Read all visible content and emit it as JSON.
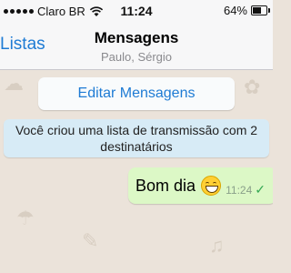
{
  "status_bar": {
    "carrier": "Claro BR",
    "time": "11:24",
    "battery_percent": "64%",
    "battery_level": 0.64,
    "wifi_icon": "wifi-icon",
    "signal_icon": "signal-dots-icon"
  },
  "nav": {
    "back_label": "Listas",
    "title": "Mensagens",
    "subtitle": "Paulo, Sérgio",
    "accent_color": "#1e7bd4"
  },
  "chat": {
    "edit_button": "Editar Mensagens",
    "system_message": "Você criou uma lista de transmissão com 2 destinatários",
    "messages": [
      {
        "text": "Bom dia",
        "emoji_icon": "smiley-icon",
        "time": "11:24",
        "status_icon": "check-icon"
      }
    ]
  }
}
